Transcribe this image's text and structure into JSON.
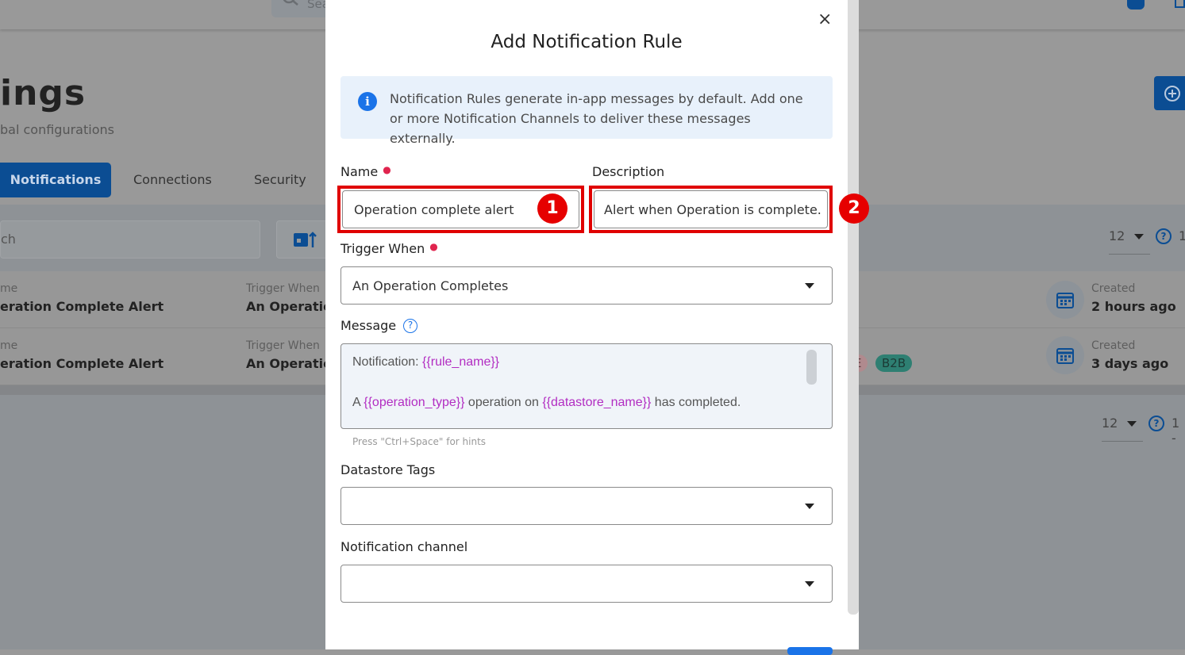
{
  "background": {
    "search_placeholder": "Sea",
    "page_title": "ings",
    "page_subtitle": "bal configurations",
    "tabs": [
      {
        "label": "Notifications",
        "active": true
      },
      {
        "label": "Connections"
      },
      {
        "label": "Security"
      }
    ],
    "search_placeholder_list": "ch",
    "page_size": "12",
    "page_range_top": "1",
    "page_range_bottom": "1 -",
    "rows": [
      {
        "name_label": "me",
        "name": "eration Complete Alert",
        "trigger_label": "Trigger When",
        "trigger": "An Operation",
        "created_label": "Created",
        "created": "2 hours ago",
        "tags": []
      },
      {
        "name_label": "me",
        "name": "eration Complete Alert",
        "trigger_label": "Trigger When",
        "trigger": "An Operation",
        "created_label": "Created",
        "created": "3 days ago",
        "tags": [
          "E",
          "B2B"
        ]
      }
    ]
  },
  "dialog": {
    "title": "Add Notification Rule",
    "info": "Notification Rules generate in-app messages by default. Add one or more Notification Channels to deliver these messages externally.",
    "name_label": "Name",
    "name_value": "Operation complete alert",
    "description_label": "Description",
    "description_value": "Alert when Operation is complete.",
    "trigger_label": "Trigger When",
    "trigger_value": "An Operation Completes",
    "message_label": "Message",
    "message": {
      "line1_prefix": "Notification: ",
      "line1_var": "{{rule_name}}",
      "line2_a": "A ",
      "line2_var1": "{{operation_type}}",
      "line2_b": " operation on ",
      "line2_var2": "{{datastore_name}}",
      "line2_c": " has completed."
    },
    "hint": "Press \"Ctrl+Space\" for hints",
    "tags_label": "Datastore Tags",
    "channel_label": "Notification channel"
  },
  "annotations": [
    "1",
    "2"
  ],
  "colors": {
    "accent": "#0b63ce",
    "highlight": "#e00000",
    "variable": "#b22dc2"
  }
}
